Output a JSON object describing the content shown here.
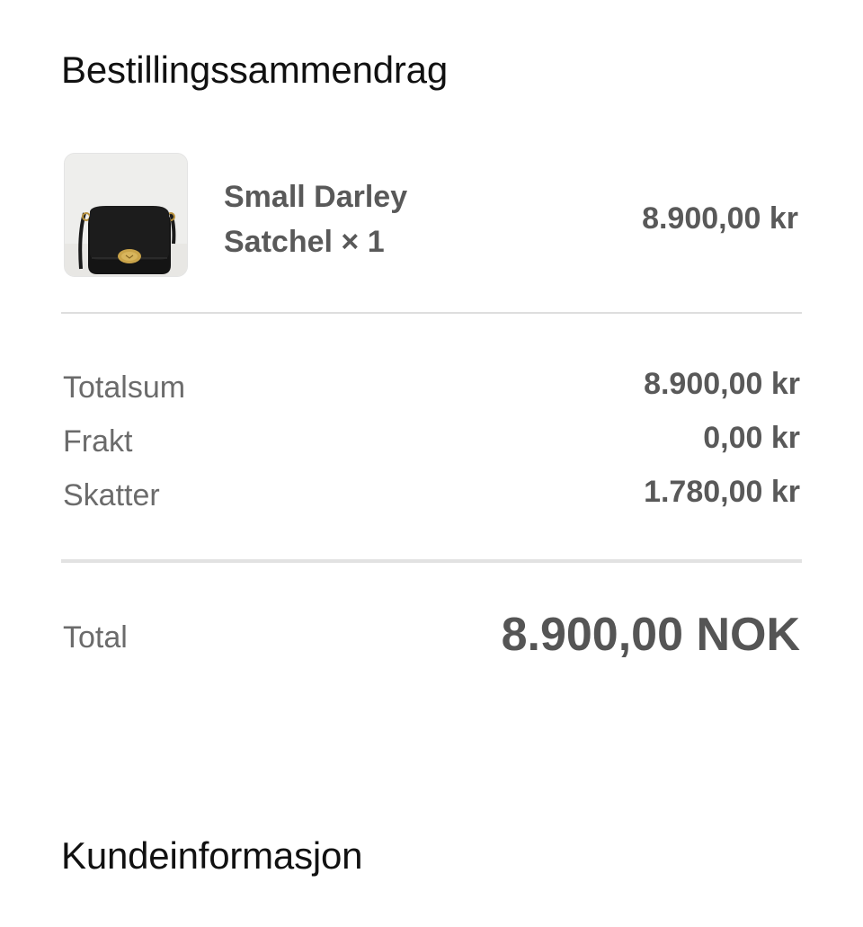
{
  "order_summary": {
    "title": "Bestillingssammendrag",
    "item": {
      "image": "black-satchel-bag-photo",
      "name": "Small Darley Satchel × 1",
      "price": "8.900,00 kr"
    },
    "totals": [
      {
        "label": "Totalsum",
        "value": "8.900,00 kr"
      },
      {
        "label": "Frakt",
        "value": "0,00 kr"
      },
      {
        "label": "Skatter",
        "value": "1.780,00 kr"
      }
    ],
    "grand_total": {
      "label": "Total",
      "value": "8.900,00 NOK"
    }
  },
  "customer_info": {
    "title": "Kundeinformasjon"
  },
  "colors": {
    "background": "#ffffff",
    "heading": "#111111",
    "label": "#6b6b6b",
    "value": "#595959",
    "divider": "#dedede"
  }
}
